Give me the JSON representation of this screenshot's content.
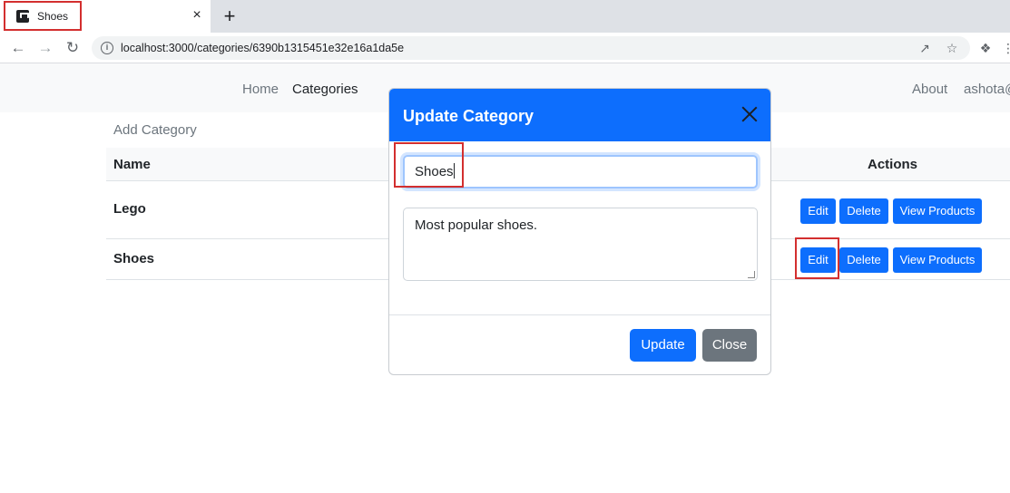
{
  "browser": {
    "tab_title": "Shoes",
    "tab_close": "×",
    "new_tab": "+",
    "url": "localhost:3000/categories/6390b1315451e32e16a1da5e",
    "icons": [
      "back-icon",
      "forward-icon",
      "reload-icon",
      "info-icon",
      "share-icon",
      "star-icon",
      "extensions-icon"
    ]
  },
  "navbar": {
    "home": "Home",
    "categories": "Categories",
    "about": "About",
    "user": "ashota@"
  },
  "page": {
    "add_category": "Add Category",
    "table": {
      "headers": {
        "name": "Name",
        "actions": "Actions"
      },
      "rows": [
        {
          "name": "Lego",
          "edit": "Edit",
          "delete": "Delete",
          "view": "View Products"
        },
        {
          "name": "Shoes",
          "edit": "Edit",
          "delete": "Delete",
          "view": "View Products"
        }
      ]
    }
  },
  "modal": {
    "title": "Update Category",
    "name_value": "Shoes",
    "description_value": "Most popular shoes.",
    "update_label": "Update",
    "close_label": "Close"
  },
  "colors": {
    "primary": "#0d6efd",
    "secondary": "#6c757d",
    "highlight": "#d32f2f"
  }
}
